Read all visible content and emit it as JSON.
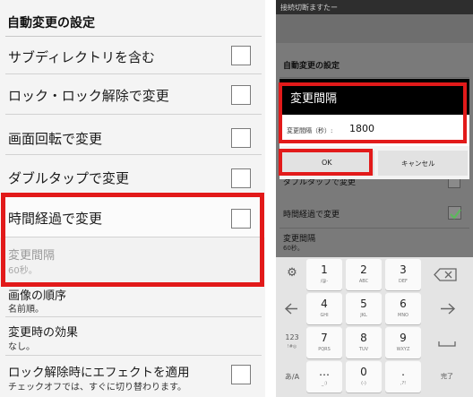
{
  "left": {
    "section_title": "自動変更の設定",
    "rows": [
      {
        "label": "サブディレクトリを含む"
      },
      {
        "label": "ロック・ロック解除で変更"
      },
      {
        "label": "画面回転で変更"
      },
      {
        "label": "ダブルタップで変更"
      },
      {
        "label": "時間経過で変更"
      }
    ],
    "interval": {
      "title": "変更間隔",
      "value": "60秒。"
    },
    "order": {
      "title": "画像の順序",
      "value": "名前順。"
    },
    "effect": {
      "title": "変更時の効果",
      "value": "なし。"
    },
    "unlock_effect": {
      "title": "ロック解除時にエフェクトを適用",
      "subtitle": "チェックオフでは、すぐに切り替わります。"
    }
  },
  "right": {
    "status_text": "接続切断ますたー",
    "section_title": "自動変更の設定",
    "bg_rows": [
      {
        "label": "ダブルタップで変更"
      },
      {
        "label": "時間経過で変更"
      }
    ],
    "bg_interval": {
      "title": "変更間隔",
      "value": "60秒。"
    },
    "dialog": {
      "title": "変更間隔",
      "field_label": "変更間隔（秒）:",
      "field_value": "1800",
      "ok_label": "OK",
      "cancel_label": "キャンセル"
    },
    "keyboard": {
      "rows": [
        {
          "left": "gear-icon",
          "keys": [
            {
              "main": "1",
              "sub": "/@-"
            },
            {
              "main": "2",
              "sub": "ABC"
            },
            {
              "main": "3",
              "sub": "DEF"
            }
          ],
          "right": "backspace-icon"
        },
        {
          "left": "left-arrow-icon",
          "keys": [
            {
              "main": "4",
              "sub": "GHI"
            },
            {
              "main": "5",
              "sub": "JKL"
            },
            {
              "main": "6",
              "sub": "MNO"
            }
          ],
          "right": "right-arrow-icon"
        },
        {
          "left": "123",
          "left_sub": "!#◎",
          "keys": [
            {
              "main": "7",
              "sub": "PQRS"
            },
            {
              "main": "8",
              "sub": "TUV"
            },
            {
              "main": "9",
              "sub": "WXYZ"
            }
          ],
          "right": "space-icon"
        },
        {
          "left": "あ/A",
          "keys": [
            {
              "main": "…",
              "sub": "_:)"
            },
            {
              "main": "0",
              "sub": "(-)"
            },
            {
              "main": ".",
              "sub": ",?!"
            }
          ],
          "right": "完了"
        }
      ]
    }
  },
  "colors": {
    "highlight": "#e21a1a",
    "accent": "#e6861a",
    "check": "#4caf50"
  }
}
